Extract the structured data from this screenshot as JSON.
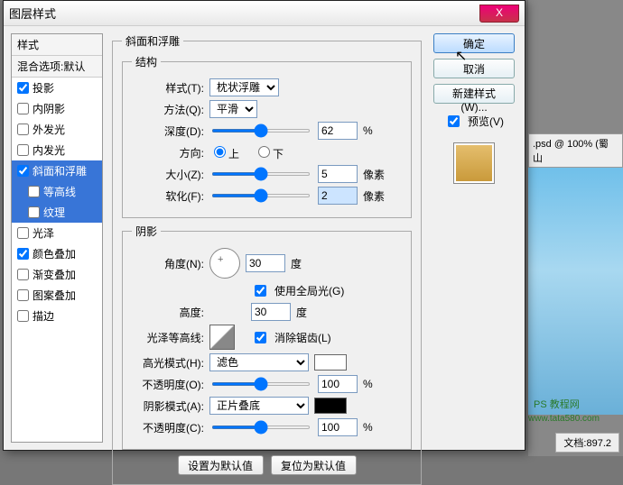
{
  "dialog": {
    "title": "图层样式"
  },
  "close_x": "X",
  "sidebar": {
    "header1": "样式",
    "header2": "混合选项:默认",
    "items": [
      {
        "label": "投影",
        "checked": true
      },
      {
        "label": "内阴影",
        "checked": false
      },
      {
        "label": "外发光",
        "checked": false
      },
      {
        "label": "内发光",
        "checked": false
      },
      {
        "label": "斜面和浮雕",
        "checked": true,
        "selected": true
      },
      {
        "label": "等高线",
        "checked": false,
        "sub": true,
        "sel2": true
      },
      {
        "label": "纹理",
        "checked": false,
        "sub": true,
        "sel2": true
      },
      {
        "label": "光泽",
        "checked": false
      },
      {
        "label": "颜色叠加",
        "checked": true
      },
      {
        "label": "渐变叠加",
        "checked": false
      },
      {
        "label": "图案叠加",
        "checked": false
      },
      {
        "label": "描边",
        "checked": false
      }
    ]
  },
  "bevel": {
    "group1_title": "斜面和浮雕",
    "structure_title": "结构",
    "style_label": "样式(T):",
    "style_value": "枕状浮雕",
    "technique_label": "方法(Q):",
    "technique_value": "平滑",
    "depth_label": "深度(D):",
    "depth_value": "62",
    "depth_unit": "%",
    "direction_label": "方向:",
    "dir_up": "上",
    "dir_down": "下",
    "size_label": "大小(Z):",
    "size_value": "5",
    "size_unit": "像素",
    "soften_label": "软化(F):",
    "soften_value": "2",
    "soften_unit": "像素",
    "shading_title": "阴影",
    "angle_label": "角度(N):",
    "angle_value": "30",
    "angle_unit": "度",
    "global_label": "使用全局光(G)",
    "altitude_label": "高度:",
    "altitude_value": "30",
    "altitude_unit": "度",
    "gloss_label": "光泽等高线:",
    "antialias_label": "消除锯齿(L)",
    "hmode_label": "高光模式(H):",
    "hmode_value": "滤色",
    "hopacity_label": "不透明度(O):",
    "hopacity_value": "100",
    "pct": "%",
    "smode_label": "阴影模式(A):",
    "smode_value": "正片叠底",
    "sopacity_label": "不透明度(C):",
    "sopacity_value": "100",
    "btn_default": "设置为默认值",
    "btn_reset": "复位为默认值"
  },
  "right": {
    "ok": "确定",
    "cancel": "取消",
    "newstyle": "新建样式(W)...",
    "preview_label": "预览(V)"
  },
  "bg": {
    "doc_tab": ".psd @ 100% (蜀 山",
    "status": "文档:897.2",
    "watermark": "PS 教程网",
    "watermark2": "www.tata580.com"
  },
  "colors": {
    "highlight": "#ffffff",
    "shadow": "#000000"
  }
}
